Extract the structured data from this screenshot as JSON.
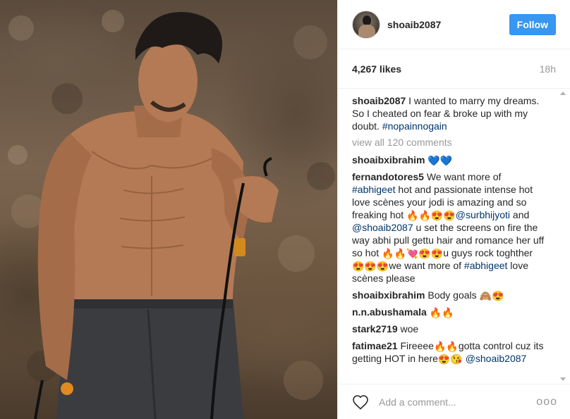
{
  "post": {
    "photo_alt": "",
    "username": "shoaib2087",
    "follow_label": "Follow",
    "likes": "4,267 likes",
    "time": "18h",
    "caption": {
      "user": "shoaib2087",
      "text": "I wanted to marry my dreams. So I cheated on fear & broke up with my doubt.",
      "hashtag": "#nopainnogain"
    },
    "view_all": "view all 120 comments",
    "comments": [
      {
        "user": "shoaibxibrahim",
        "segments": [
          {
            "type": "emoji",
            "v": "💙💙"
          }
        ]
      },
      {
        "user": "fernandotores5",
        "segments": [
          {
            "type": "text",
            "v": "We want more of "
          },
          {
            "type": "link",
            "v": "#abhigeet"
          },
          {
            "type": "text",
            "v": " hot and passionate intense hot love scènes your jodi is amazing and so freaking hot "
          },
          {
            "type": "emoji",
            "v": "🔥🔥😍😍"
          },
          {
            "type": "link",
            "v": "@surbhijyoti"
          },
          {
            "type": "text",
            "v": " and "
          },
          {
            "type": "link",
            "v": "@shoaib2087"
          },
          {
            "type": "text",
            "v": " u set the screens on fire the way abhi pull gettu hair and romance her uff so hot "
          },
          {
            "type": "emoji",
            "v": "🔥🔥💘😍😍"
          },
          {
            "type": "text",
            "v": "u guys rock toghther "
          },
          {
            "type": "emoji",
            "v": "😍😍😍"
          },
          {
            "type": "text",
            "v": "we want more of "
          },
          {
            "type": "link",
            "v": "#abhigeet"
          },
          {
            "type": "text",
            "v": " love scènes please"
          }
        ]
      },
      {
        "user": "shoaibxibrahim",
        "segments": [
          {
            "type": "text",
            "v": "Body goals "
          },
          {
            "type": "emoji",
            "v": "🙈😍"
          }
        ]
      },
      {
        "user": "n.n.abushamala",
        "segments": [
          {
            "type": "emoji",
            "v": "🔥🔥"
          }
        ]
      },
      {
        "user": "stark2719",
        "segments": [
          {
            "type": "text",
            "v": "woe"
          }
        ]
      },
      {
        "user": "fatimae21",
        "segments": [
          {
            "type": "text",
            "v": "Fireeee"
          },
          {
            "type": "emoji",
            "v": "🔥🔥"
          },
          {
            "type": "text",
            "v": "gotta control cuz its getting HOT in here"
          },
          {
            "type": "emoji",
            "v": "😍😘"
          },
          {
            "type": "text",
            "v": " "
          },
          {
            "type": "link",
            "v": "@shoaib2087"
          }
        ]
      }
    ],
    "add_comment_placeholder": "Add a comment...",
    "more_label": "ooo"
  },
  "colors": {
    "follow": "#3897f0",
    "link": "#003569",
    "muted": "#999999",
    "border": "#efefef"
  },
  "icons": {
    "like": "heart-outline-icon",
    "more": "more-options-icon"
  }
}
